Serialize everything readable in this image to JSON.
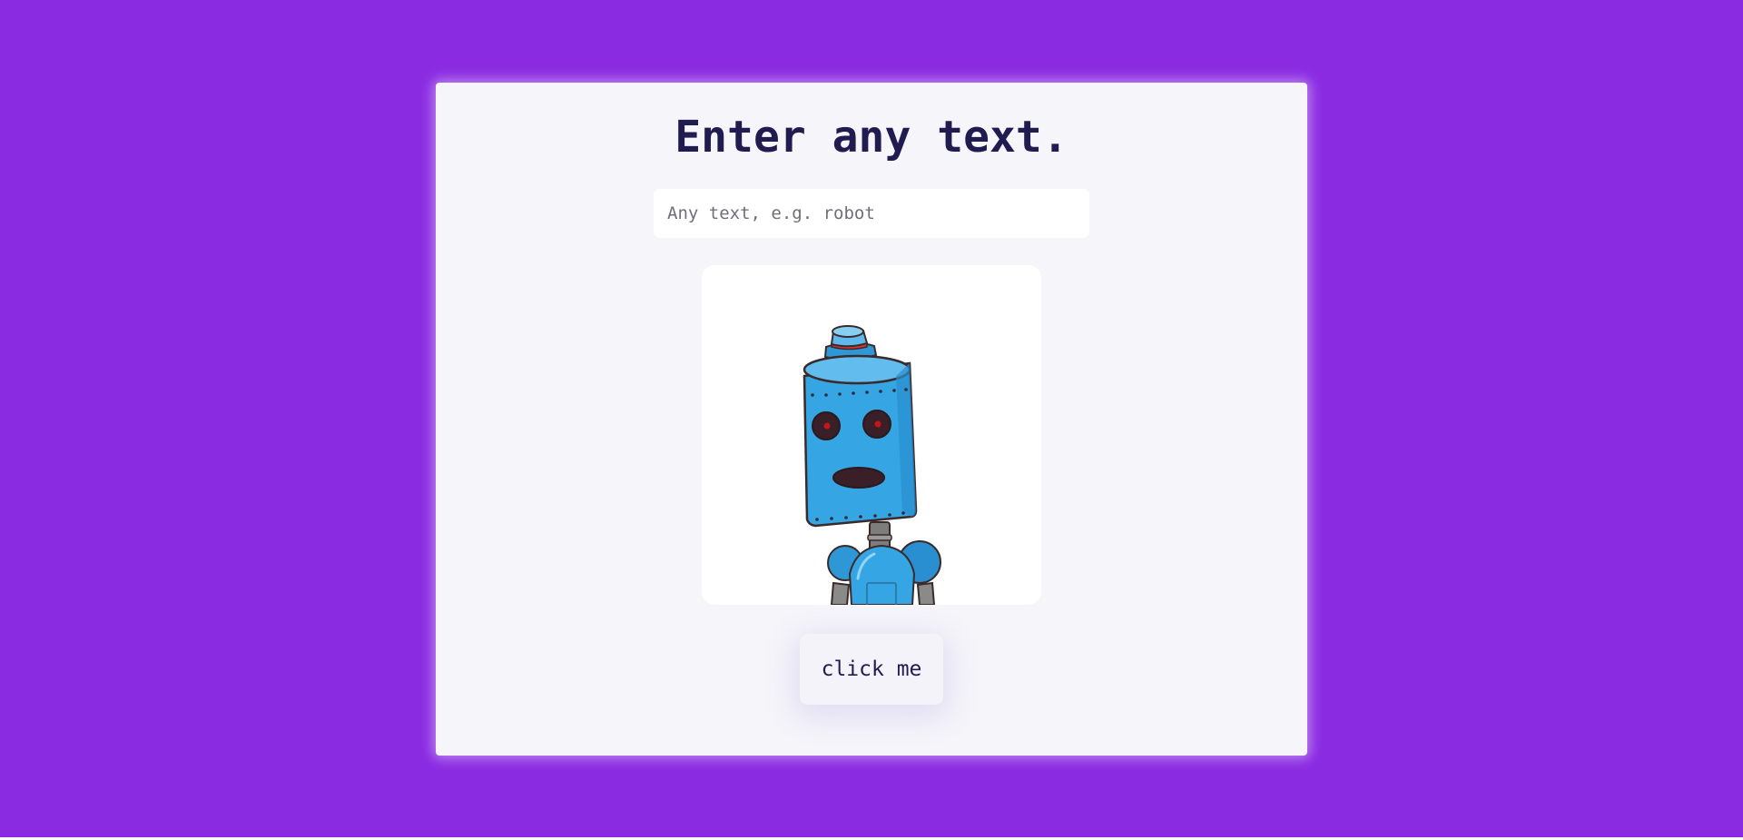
{
  "heading": {
    "title": "Enter any text."
  },
  "input": {
    "value": "",
    "placeholder": "Any text, e.g. robot"
  },
  "image": {
    "subject": "robot",
    "alt": "robot"
  },
  "button": {
    "label": "click me"
  },
  "colors": {
    "page_background": "#8a2be2",
    "card_background": "#f6f5fa",
    "heading_text": "#211c50",
    "robot_body": "#35a6e3",
    "robot_outline": "#3b2a2a",
    "robot_eye": "#c01818",
    "robot_neck": "#7d7d7d"
  },
  "icons": {
    "generated_image": "robot-illustration"
  }
}
